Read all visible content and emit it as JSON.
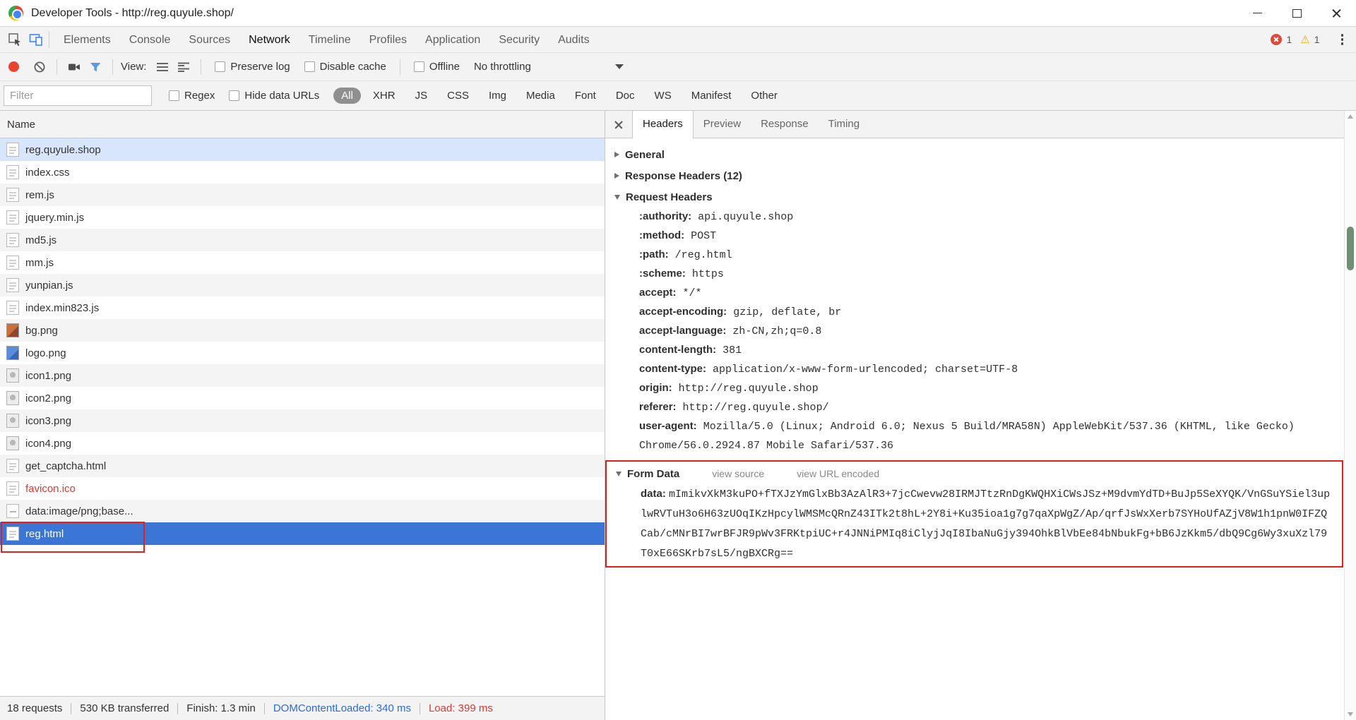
{
  "colors": {
    "selection_blue": "#3b76d6",
    "highlight_blue": "#d7e6fb",
    "error_red": "#d93a31",
    "link_blue": "#2d6bd8",
    "annotation_red": "#e01f1f",
    "active_filter_gray": "#8f8f8f",
    "warning_yellow": "#f2a900",
    "device_mode_blue": "#4285f4"
  },
  "window": {
    "title": "Developer Tools - http://reg.quyule.shop/"
  },
  "devtools": {
    "tabs": [
      "Elements",
      "Console",
      "Sources",
      "Network",
      "Timeline",
      "Profiles",
      "Application",
      "Security",
      "Audits"
    ],
    "active_tab": "Network",
    "error_count": "1",
    "warning_count": "1"
  },
  "network_toolbar": {
    "view_label": "View:",
    "checkboxes": [
      "Preserve log",
      "Disable cache",
      "Offline"
    ],
    "throttling_value": "No throttling"
  },
  "filter_bar": {
    "placeholder": "Filter",
    "regex_label": "Regex",
    "hide_data_urls_label": "Hide data URLs",
    "types": [
      "All",
      "XHR",
      "JS",
      "CSS",
      "Img",
      "Media",
      "Font",
      "Doc",
      "WS",
      "Manifest",
      "Other"
    ],
    "active_type": "All"
  },
  "request_list": {
    "column_header": "Name",
    "rows": [
      {
        "name": "reg.quyule.shop",
        "icon": "doc",
        "state": "highlight"
      },
      {
        "name": "index.css",
        "icon": "doc"
      },
      {
        "name": "rem.js",
        "icon": "doc"
      },
      {
        "name": "jquery.min.js",
        "icon": "doc"
      },
      {
        "name": "md5.js",
        "icon": "doc"
      },
      {
        "name": "mm.js",
        "icon": "doc"
      },
      {
        "name": "yunpian.js",
        "icon": "doc"
      },
      {
        "name": "index.min823.js",
        "icon": "doc"
      },
      {
        "name": "bg.png",
        "icon": "img-red"
      },
      {
        "name": "logo.png",
        "icon": "img-blue"
      },
      {
        "name": "icon1.png",
        "icon": "img-gray"
      },
      {
        "name": "icon2.png",
        "icon": "img-gray"
      },
      {
        "name": "icon3.png",
        "icon": "img-gray"
      },
      {
        "name": "icon4.png",
        "icon": "img-gray"
      },
      {
        "name": "get_captcha.html",
        "icon": "doc"
      },
      {
        "name": "favicon.ico",
        "icon": "doc",
        "error": true
      },
      {
        "name": "data:image/png;base...",
        "icon": "data"
      },
      {
        "name": "reg.html",
        "icon": "doc",
        "state": "selected"
      }
    ]
  },
  "details": {
    "tabs": [
      "Headers",
      "Preview",
      "Response",
      "Timing"
    ],
    "active_tab": "Headers",
    "sections": [
      {
        "label": "General",
        "expanded": false
      },
      {
        "label": "Response Headers (12)",
        "expanded": false
      },
      {
        "label": "Request Headers",
        "expanded": true
      },
      {
        "label": "Form Data",
        "expanded": true
      }
    ],
    "request_headers": [
      {
        "name": ":authority:",
        "value": "api.quyule.shop"
      },
      {
        "name": ":method:",
        "value": "POST"
      },
      {
        "name": ":path:",
        "value": "/reg.html"
      },
      {
        "name": ":scheme:",
        "value": "https"
      },
      {
        "name": "accept:",
        "value": "*/*"
      },
      {
        "name": "accept-encoding:",
        "value": "gzip, deflate, br"
      },
      {
        "name": "accept-language:",
        "value": "zh-CN,zh;q=0.8"
      },
      {
        "name": "content-length:",
        "value": "381"
      },
      {
        "name": "content-type:",
        "value": "application/x-www-form-urlencoded; charset=UTF-8"
      },
      {
        "name": "origin:",
        "value": "http://reg.quyule.shop"
      },
      {
        "name": "referer:",
        "value": "http://reg.quyule.shop/"
      },
      {
        "name": "user-agent:",
        "value": "Mozilla/5.0 (Linux; Android 6.0; Nexus 5 Build/MRA58N) AppleWebKit/537.36 (KHTML, like Gecko) Chrome/56.0.2924.87 Mobile Safari/537.36"
      }
    ],
    "form_data": {
      "links": [
        "view source",
        "view URL encoded"
      ],
      "entries": [
        {
          "name": "data:",
          "value": "mImikvXkM3kuPO+fTXJzYmGlxBb3AzAlR3+7jcCwevw28IRMJTtzRnDgKWQHXiCWsJSz+M9dvmYdTD+BuJp5SeXYQK/VnGSuYSiel3uplwRVTuH3o6H63zUOqIKzHpcylWMSMcQRnZ43ITk2t8hL+2Y8i+Ku35ioa1g7g7qaXpWgZ/Ap/qrfJsWxXerb7SYHoUfAZjV8W1h1pnW0IFZQCab/cMNrBI7wrBFJR9pWv3FRKtpiUC+r4JNNiPMIq8iClyjJqI8IbaNuGjy394OhkBlVbEe84bNbukFg+bB6JzKkm5/dbQ9Cg6Wy3xuXzl79T0xE66SKrb7sL5/ngBXCRg=="
        }
      ]
    }
  },
  "status_bar": {
    "items": [
      {
        "label": "18 requests"
      },
      {
        "label": "530 KB transferred"
      },
      {
        "label": "Finish: 1.3 min"
      },
      {
        "label": "DOMContentLoaded: 340 ms",
        "style": "blue"
      },
      {
        "label": "Load: 399 ms",
        "style": "red"
      }
    ]
  }
}
